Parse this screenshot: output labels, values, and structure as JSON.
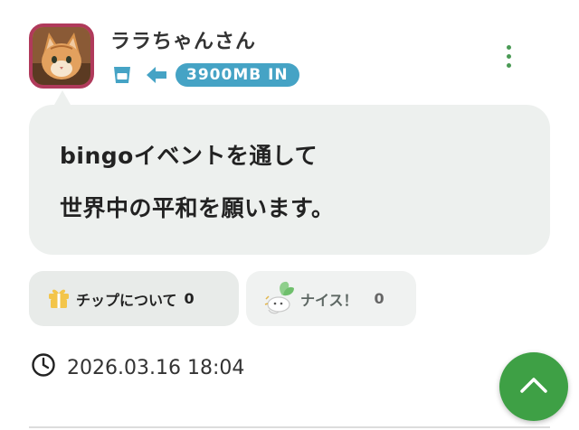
{
  "post": {
    "author": "ララちゃんさん",
    "transfer_badge": "3900MB IN",
    "message_lines": [
      "bingoイベントを通して",
      "世界中の平和を願います。"
    ],
    "timestamp": "2026.03.16 18:04"
  },
  "actions": {
    "tip_label": "チップについて",
    "tip_count": "0",
    "nice_label": "ナイス！",
    "nice_count": "0"
  },
  "icons": {
    "cup": "cup-icon",
    "arrow": "arrow-left-icon",
    "menu": "more-vertical-icon",
    "gift": "gift-icon",
    "nice": "nice-character-icon",
    "clock": "clock-icon",
    "scroll_top": "chevron-up-icon"
  },
  "colors": {
    "accent_green": "#3ea045",
    "badge_blue": "#45a3c5",
    "avatar_border": "#b03a5b",
    "bubble_bg": "#edf0ee",
    "gift_yellow": "#f3c54a"
  }
}
